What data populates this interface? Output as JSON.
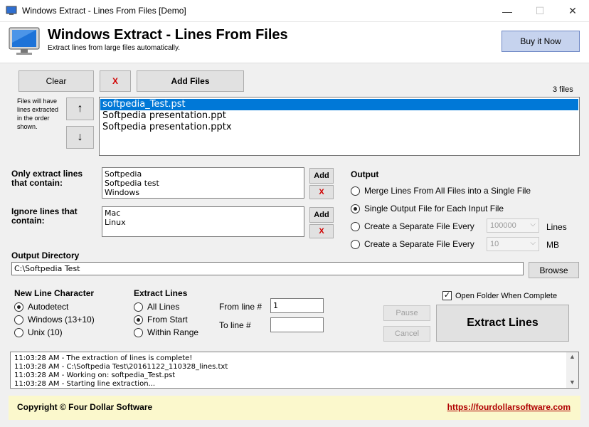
{
  "window": {
    "title": "Windows Extract - Lines From Files [Demo]"
  },
  "header": {
    "title": "Windows Extract - Lines From Files",
    "subtitle": "Extract lines from large files automatically.",
    "buy_label": "Buy it Now"
  },
  "files": {
    "clear_label": "Clear",
    "remove_label": "X",
    "add_label": "Add Files",
    "count": "3 files",
    "order_note": "Files will have lines extracted in the order shown.",
    "up_label": "↑",
    "down_label": "↓",
    "items": [
      "softpedia_Test.pst",
      "Softpedia presentation.ppt",
      "Softpedia presentation.pptx"
    ],
    "selected_index": 0
  },
  "filters": {
    "include_label": "Only extract lines that contain:",
    "include_lines": [
      "Softpedia",
      "Softpedia test",
      "Windows"
    ],
    "ignore_label": "Ignore lines that contain:",
    "ignore_lines": [
      "Mac",
      "Linux"
    ],
    "add_label": "Add",
    "remove_label": "X"
  },
  "output": {
    "heading": "Output",
    "merge_label": "Merge Lines From All Files into a Single File",
    "single_label": "Single Output File for Each Input File",
    "every_lines_label": "Create a Separate File Every",
    "every_lines_value": "100000",
    "every_lines_unit": "Lines",
    "every_mb_label": "Create a Separate File Every",
    "every_mb_value": "10",
    "every_mb_unit": "MB",
    "selected": "single"
  },
  "output_dir": {
    "label": "Output Directory",
    "value": "C:\\Softpedia Test",
    "browse_label": "Browse"
  },
  "newline": {
    "heading": "New Line Character",
    "options": [
      "Autodetect",
      "Windows (13+10)",
      "Unix (10)"
    ],
    "selected": 0
  },
  "extract": {
    "heading": "Extract Lines",
    "options": [
      "All Lines",
      "From Start",
      "Within Range"
    ],
    "selected": 1,
    "from_label": "From line #",
    "from_value": "1",
    "to_label": "To line #",
    "to_value": ""
  },
  "actions": {
    "open_folder_label": "Open Folder When Complete",
    "open_folder_checked": true,
    "pause_label": "Pause",
    "cancel_label": "Cancel",
    "extract_label": "Extract Lines"
  },
  "log": [
    "11:03:28 AM - The extraction of lines is complete!",
    "11:03:28 AM - C:\\Softpedia Test\\20161122_110328_lines.txt",
    "11:03:28 AM - Working on: softpedia_Test.pst",
    "11:03:28 AM - Starting line extraction..."
  ],
  "footer": {
    "copyright": "Copyright © Four Dollar Software",
    "link": "https://fourdollarsoftware.com"
  }
}
